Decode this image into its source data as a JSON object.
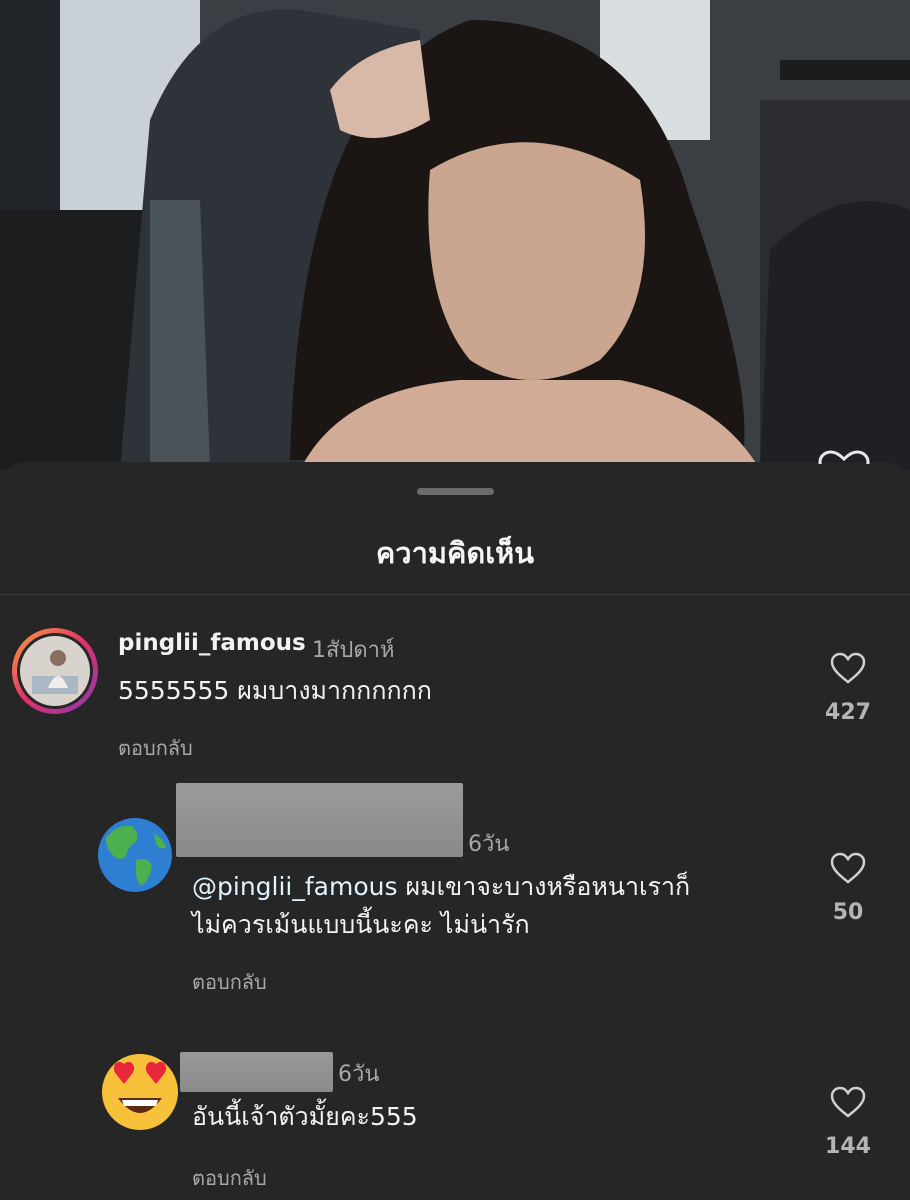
{
  "sheet": {
    "title": "ความคิดเห็น"
  },
  "comments": [
    {
      "username": "pinglii_famous",
      "time": "1สัปดาห์",
      "text": "5555555 ผมบางมากกกกกก",
      "reply_label": "ตอบกลับ",
      "likes": "427",
      "avatar_icon": "profile-photo"
    },
    {
      "username": "",
      "time": "6วัน",
      "mention": "@pinglii_famous",
      "text_line1": " ผมเขาจะบางหรือหนาเราก็",
      "text_line2": "ไม่ควรเม้นแบบนี้นะคะ ไม่น่ารัก",
      "reply_label": "ตอบกลับ",
      "likes": "50",
      "avatar_icon": "globe-emoji"
    },
    {
      "username": "",
      "time": "6วัน",
      "text": "อันนี้เจ้าตัวมั้ยคะ555",
      "reply_label": "ตอบกลับ",
      "likes": "144",
      "avatar_icon": "heart-eyes-emoji"
    }
  ],
  "colors": {
    "sheet_bg": "#262626",
    "text": "#f2f2f2",
    "muted": "#a8a8a8"
  }
}
